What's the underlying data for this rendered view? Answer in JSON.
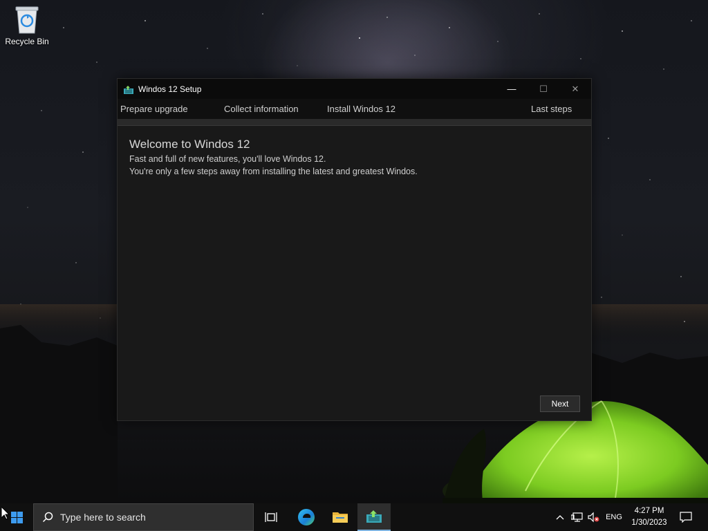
{
  "desktop": {
    "icons": [
      {
        "label": "Recycle Bin",
        "icon": "recycle-bin-icon"
      }
    ]
  },
  "window": {
    "title": "Windos 12 Setup",
    "controls": {
      "minimize": "—",
      "maximize": "☐",
      "close": "✕"
    },
    "steps": [
      "Prepare upgrade",
      "Collect information",
      "Install Windos 12",
      "Last steps"
    ],
    "progress_fraction": 0.0,
    "content": {
      "heading": "Welcome to Windos 12",
      "line1": "Fast and full of new features, you'll love Windos 12.",
      "line2": "You're only a few steps away from installing the latest and greatest Windos."
    },
    "next_label": "Next"
  },
  "taskbar": {
    "search_placeholder": "Type here to search",
    "apps": [
      "task-view-icon",
      "edge-icon",
      "file-explorer-icon",
      "setup-app-icon"
    ],
    "tray": {
      "language": "ENG",
      "time": "4:27 PM",
      "date": "1/30/2023"
    }
  },
  "colors": {
    "window_bg": "#191919",
    "titlebar_bg": "#0b0b0b",
    "taskbar_bg": "#101010",
    "tent_glow": "#7ccb21",
    "active_indicator": "#7fb3e0"
  }
}
